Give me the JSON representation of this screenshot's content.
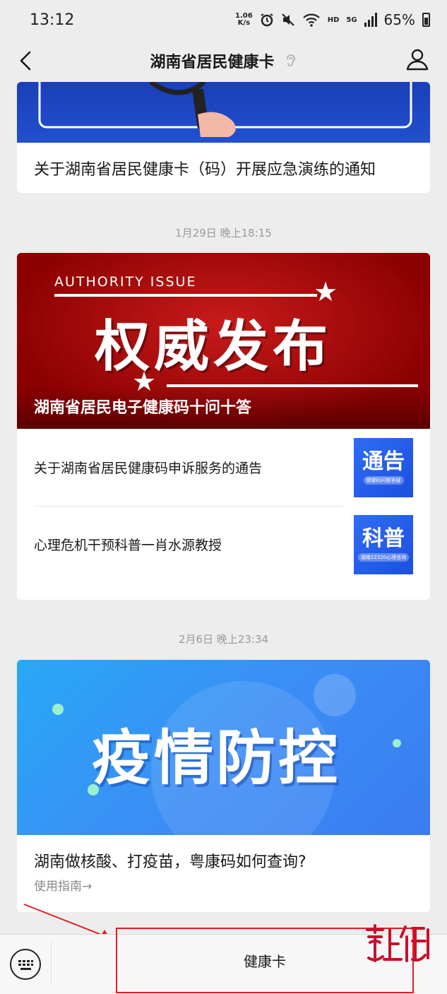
{
  "status_bar": {
    "time": "13:12",
    "net_speed_value": "1.06",
    "net_speed_unit": "K/s",
    "hd": "HD",
    "network": "5G",
    "battery": "65%"
  },
  "nav": {
    "title": "湖南省居民健康卡"
  },
  "articles": [
    {
      "title": "关于湖南省居民健康卡（码）开展应急演练的通知"
    },
    {
      "timestamp": "1月29日 晚上18:15",
      "banner_en": "AUTHORITY ISSUE",
      "banner_title": "权威发布",
      "banner_caption": "湖南省居民电子健康码十问十答",
      "sub_items": [
        {
          "text": "关于湖南省居民健康码申诉服务的通告",
          "thumb_label": "通告",
          "thumb_small": "健康码问题答疑"
        },
        {
          "text": "心理危机干预科普一肖水源教授",
          "thumb_label": "科普",
          "thumb_small": "湖南12320心理咨询"
        }
      ]
    },
    {
      "timestamp": "2月6日 晚上23:34",
      "banner_title": "疫情防控",
      "title": "湖南做核酸、打疫苗，粤康码如何查询?",
      "guide": "使用指南→"
    }
  ],
  "bottom": {
    "menu_label": "健康卡"
  },
  "watermark": "掌上衡陽",
  "colors": {
    "accent_red": "#e02020",
    "blue_banner": "#2250d0",
    "red_banner": "#c81b1b"
  }
}
